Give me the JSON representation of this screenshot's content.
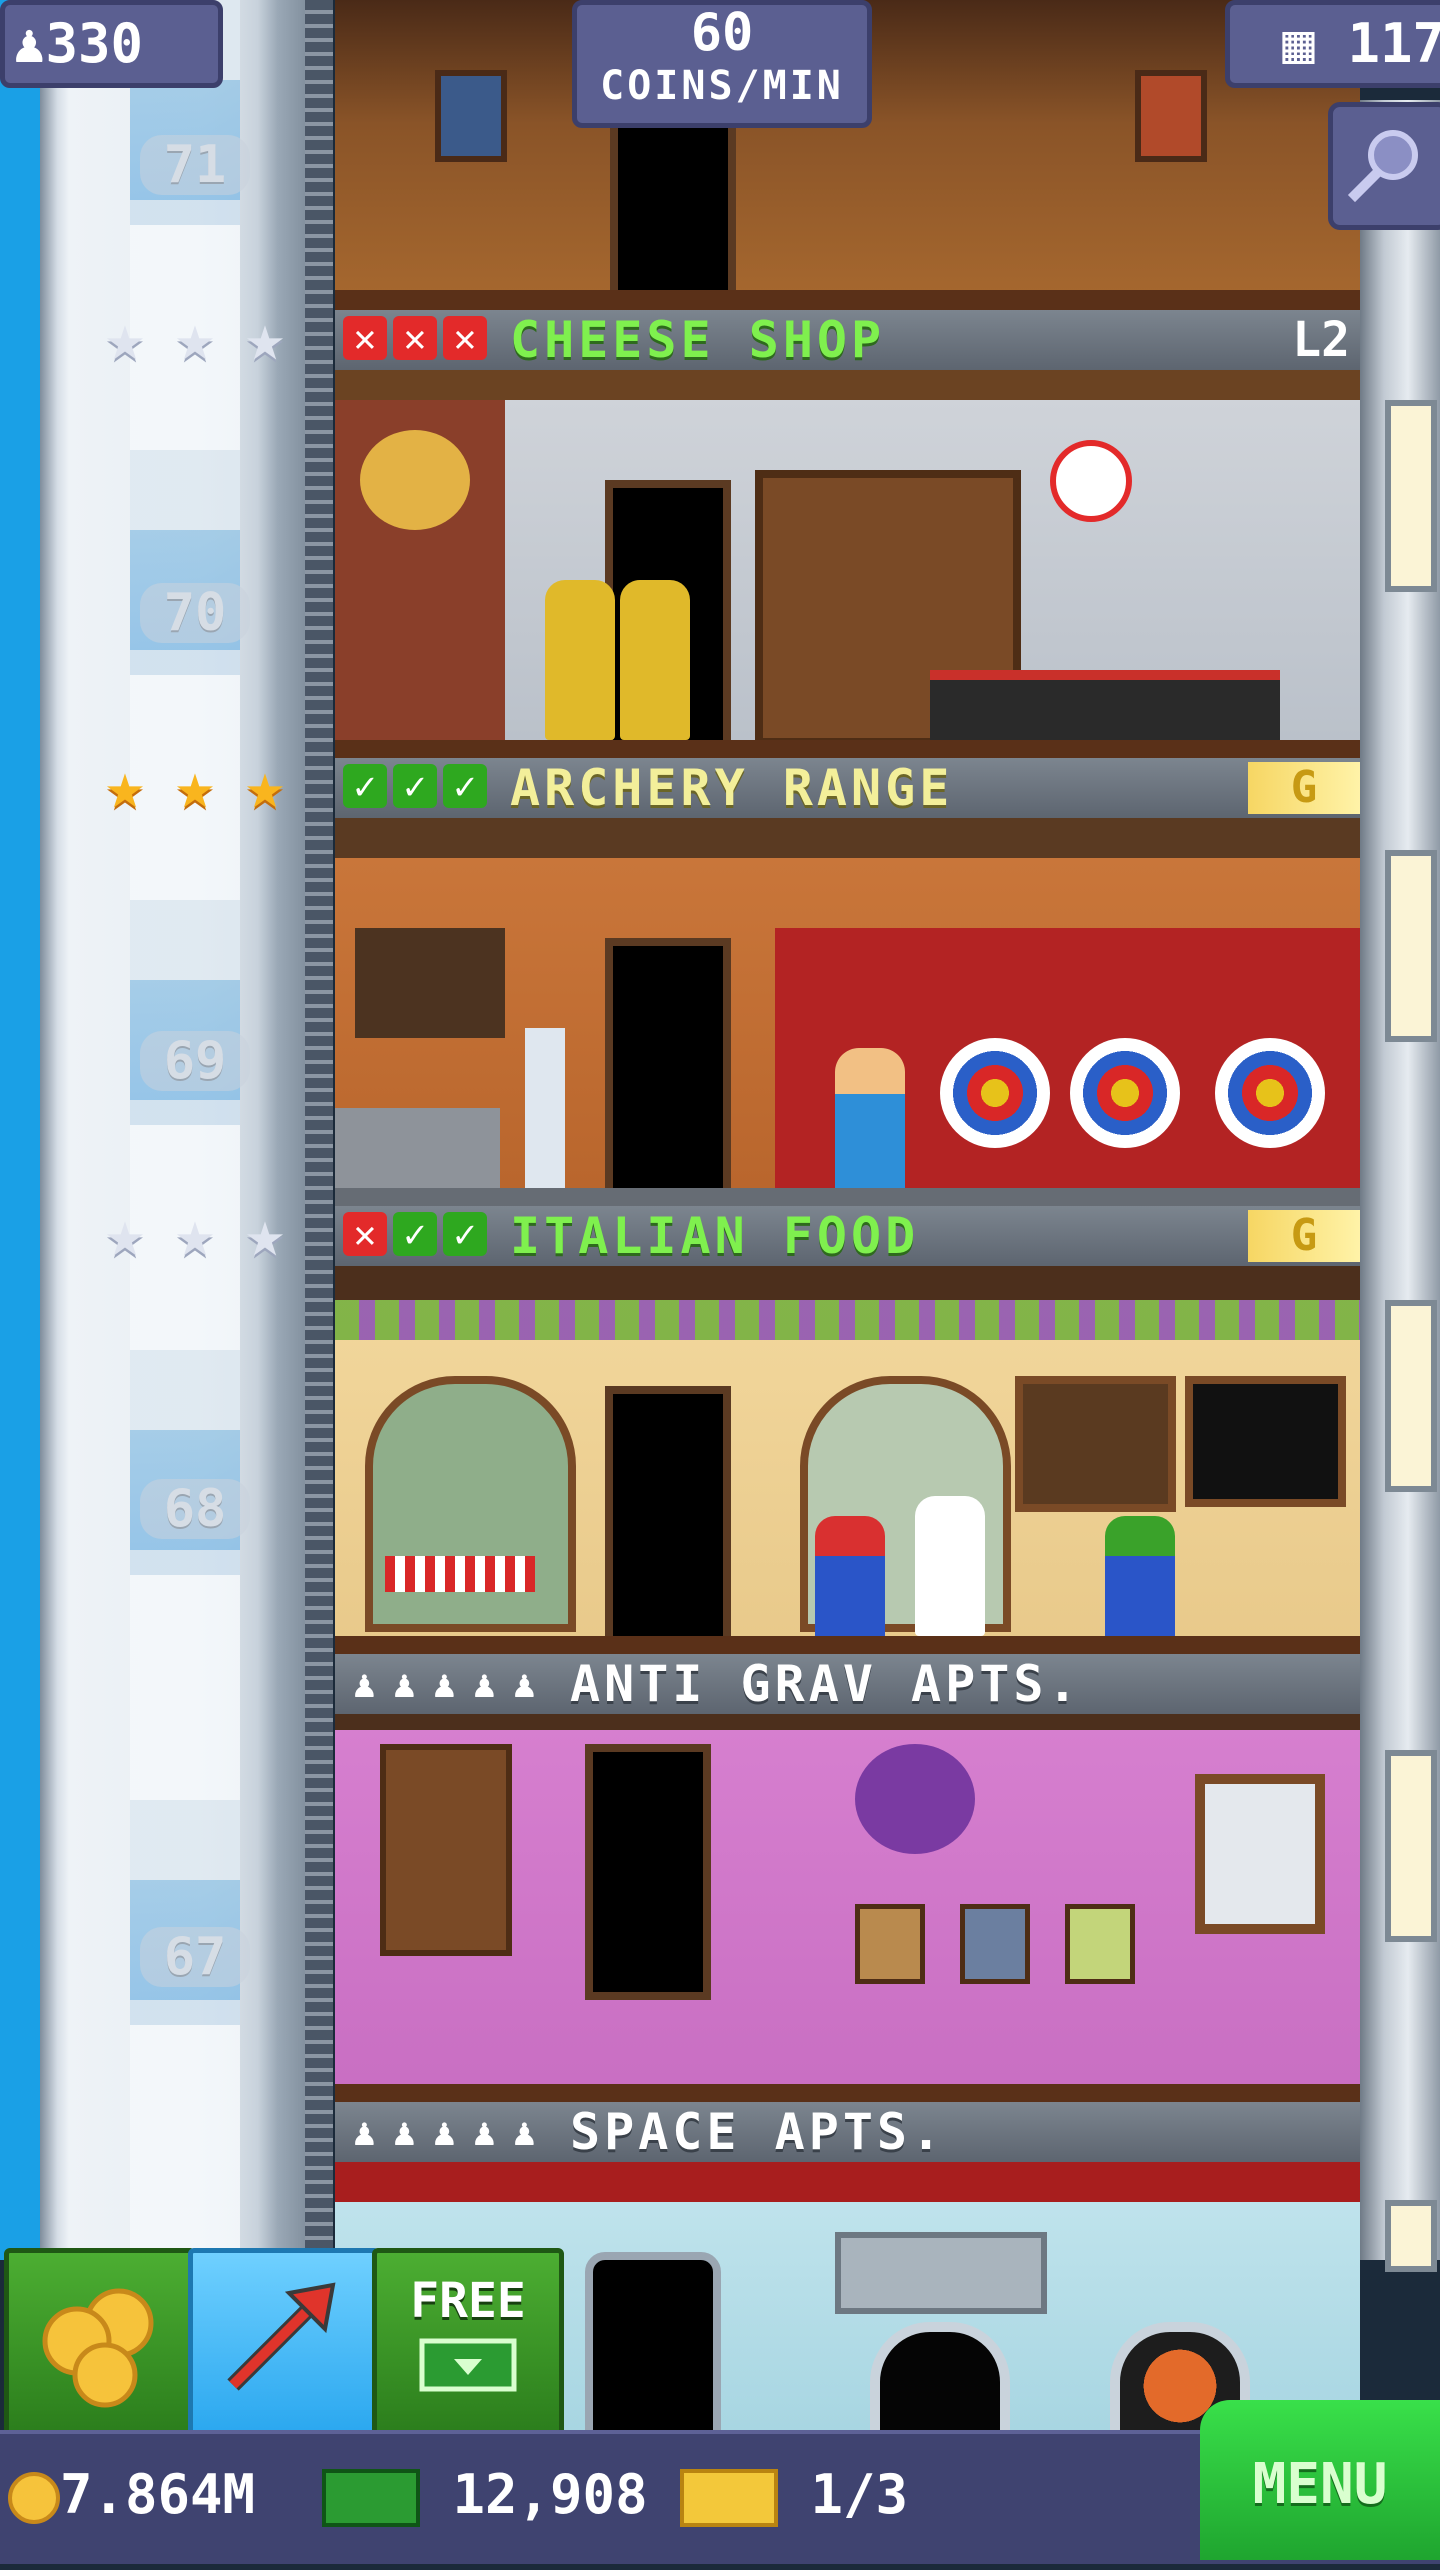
{
  "hud": {
    "population": "330",
    "income_value": "60",
    "income_unit": "COINS/MIN",
    "floor_count": "117"
  },
  "elevator": {
    "floor_numbers": [
      "71",
      "70",
      "69",
      "68",
      "67"
    ]
  },
  "floors": [
    {
      "name": "CHEESE SHOP",
      "type": "business",
      "marks": [
        "x",
        "x",
        "x"
      ],
      "stars": "silver",
      "tag": "L2"
    },
    {
      "name": "ARCHERY RANGE",
      "type": "business",
      "marks": [
        "ok",
        "ok",
        "ok"
      ],
      "stars": "gold",
      "tag": "G"
    },
    {
      "name": "ITALIAN FOOD",
      "type": "business",
      "marks": [
        "x",
        "ok",
        "ok"
      ],
      "stars": "silver",
      "tag": "G"
    },
    {
      "name": "ANTI GRAV APTS.",
      "type": "residential"
    },
    {
      "name": "SPACE APTS.",
      "type": "residential"
    }
  ],
  "buttons": {
    "free_label": "FREE"
  },
  "bottom_bar": {
    "coins": "7.864M",
    "bux": "12,908",
    "tickets": "1/3",
    "menu_label": "MENU"
  },
  "colors": {
    "sky": "#1aa0e6",
    "hud_bg": "#5b5f91",
    "banner_green_text": "#7ff04e",
    "banner_yellow_text": "#f3ef9a",
    "menu_green": "#2fc43f"
  },
  "icons": [
    "person-icon",
    "building-icon",
    "search-icon",
    "star-icon",
    "x-mark-icon",
    "check-mark-icon",
    "gold-badge-icon",
    "coins-icon",
    "elevator-arrow-icon",
    "bux-icon",
    "ticket-icon"
  ]
}
